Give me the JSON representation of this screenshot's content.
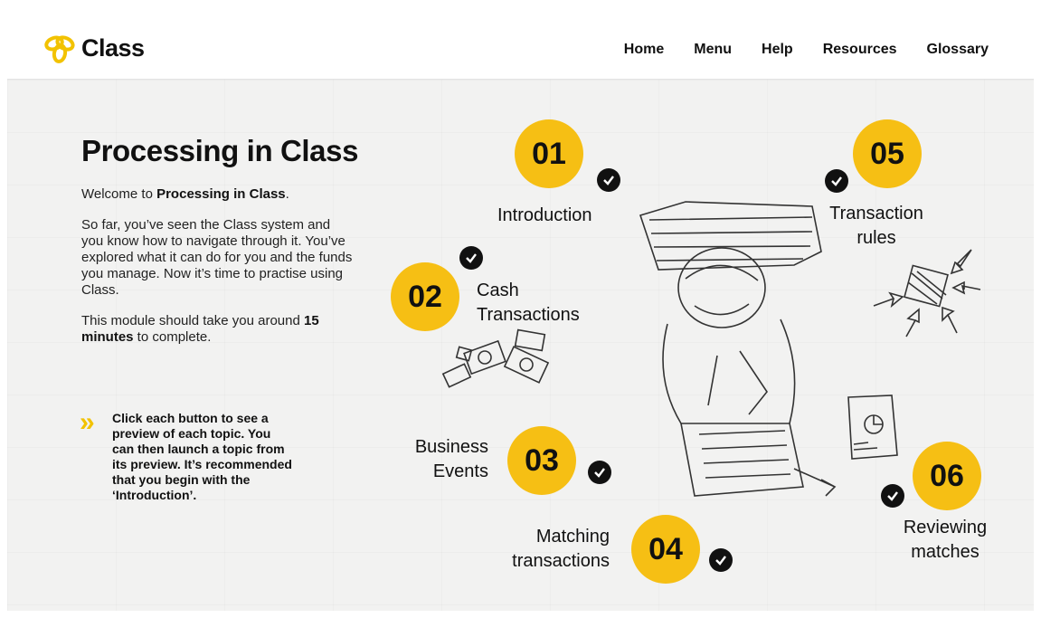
{
  "header": {
    "logo_text": "Class",
    "nav": [
      "Home",
      "Menu",
      "Help",
      "Resources",
      "Glossary"
    ]
  },
  "intro": {
    "title": "Processing in Class",
    "welcome_prefix": "Welcome to ",
    "welcome_bold": "Processing in Class",
    "welcome_suffix": ".",
    "paragraph2": "So far, you’ve seen the Class system and you know how to navigate through it. You’ve explored what it can do for you and the funds you manage. Now it’s time to practise using Class.",
    "duration_prefix": "This module should take you around ",
    "duration_bold": "15 minutes",
    "duration_suffix": " to complete.",
    "tip_icon": "»",
    "tip": "Click each button to see a preview of each topic. You can then launch a topic from its preview. It’s recommended that you begin with the ‘Introduction’."
  },
  "topics": [
    {
      "number": "01",
      "line1": "Introduction",
      "line2": "",
      "completed": true
    },
    {
      "number": "02",
      "line1": "Cash",
      "line2": "Transactions",
      "completed": true
    },
    {
      "number": "03",
      "line1": "Business",
      "line2": "Events",
      "completed": true
    },
    {
      "number": "04",
      "line1": "Matching",
      "line2": "transactions",
      "completed": true
    },
    {
      "number": "05",
      "line1": "Transaction",
      "line2": "rules",
      "completed": true
    },
    {
      "number": "06",
      "line1": "Reviewing",
      "line2": "matches",
      "completed": true
    }
  ],
  "colors": {
    "accent": "#f6bf14",
    "check": "#111111",
    "text": "#111111"
  },
  "icons": [
    "class-logo-icon",
    "double-chevron-icon",
    "checkmark-icon",
    "person-sketch-illustration",
    "money-sketch-illustration",
    "network-sketch-illustration",
    "report-sketch-illustration"
  ]
}
